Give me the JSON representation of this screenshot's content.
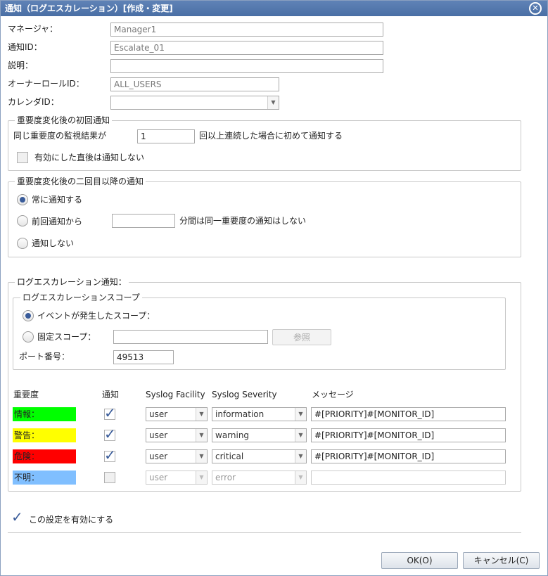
{
  "window": {
    "title": "通知（ログエスカレーション）[作成・変更]",
    "close_icon": "close-icon"
  },
  "form": {
    "manager_label": "マネージャ：",
    "manager_value": "Manager1",
    "notify_id_label": "通知ID：",
    "notify_id_value": "Escalate_01",
    "desc_label": "説明：",
    "desc_value": "",
    "owner_label": "オーナーロールID：",
    "owner_value": "ALL_USERS",
    "calendar_label": "カレンダID：",
    "calendar_value": ""
  },
  "first_notify": {
    "legend": "重要度変化後の初回通知",
    "prefix": "同じ重要度の監視結果が",
    "count": "1",
    "suffix": "回以上連続した場合に初めて通知する",
    "no_notify_after_enable": "有効にした直後は通知しない"
  },
  "second_notify": {
    "legend": "重要度変化後の二回目以降の通知",
    "always": "常に通知する",
    "from_previous": "前回通知から",
    "minutes_value": "",
    "minutes_suffix": "分間は同一重要度の通知はしない",
    "none": "通知しない"
  },
  "log_escalation": {
    "legend": "ログエスカレーション通知：",
    "scope_legend": "ログエスカレーションスコープ",
    "event_scope": "イベントが発生したスコープ：",
    "fixed_scope": "固定スコープ：",
    "fixed_scope_value": "",
    "browse": "参照",
    "port_label": "ポート番号：",
    "port_value": "49513",
    "headers": {
      "severity": "重要度",
      "notify": "通知",
      "facility": "Syslog Facility",
      "sev": "Syslog Severity",
      "message": "メッセージ"
    },
    "rows": [
      {
        "label": "情報：",
        "color": "#00ff00",
        "checked": true,
        "facility": "user",
        "severity": "information",
        "message": "#[PRIORITY]#[MONITOR_ID]"
      },
      {
        "label": "警告：",
        "color": "#ffff00",
        "checked": true,
        "facility": "user",
        "severity": "warning",
        "message": "#[PRIORITY]#[MONITOR_ID]"
      },
      {
        "label": "危険：",
        "color": "#ff0000",
        "checked": true,
        "facility": "user",
        "severity": "critical",
        "message": "#[PRIORITY]#[MONITOR_ID]"
      },
      {
        "label": "不明：",
        "color": "#80bfff",
        "checked": false,
        "facility": "user",
        "severity": "error",
        "message": ""
      }
    ]
  },
  "enable_setting": "この設定を有効にする",
  "buttons": {
    "ok": "OK(O)",
    "cancel": "キャンセル(C)"
  }
}
